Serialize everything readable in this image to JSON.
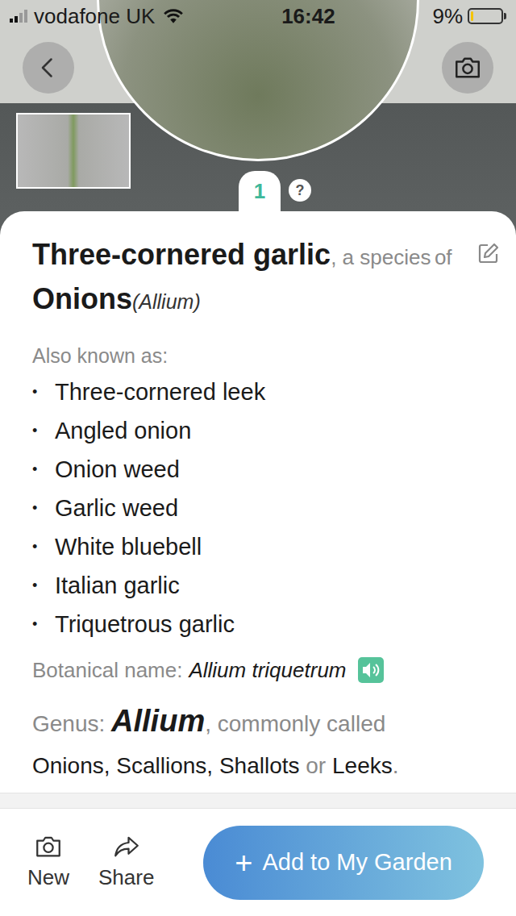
{
  "status_bar": {
    "carrier": "vodafone UK",
    "time": "16:42",
    "battery": "9%",
    "battery_level": 0.09
  },
  "header": {
    "photo_count": "1",
    "help": "?"
  },
  "plant": {
    "name": "Three-cornered garlic",
    "species_of": ", a species",
    "of": "of",
    "genus_common": "Onions",
    "genus_latin": "(Allium)"
  },
  "aliases_label": "Also known as:",
  "bullet": "•",
  "aliases": [
    "Three-cornered leek",
    "Angled onion",
    "Onion weed",
    "Garlic weed",
    "White bluebell",
    "Italian garlic",
    "Triquetrous garlic"
  ],
  "botanical": {
    "label": "Botanical name:",
    "value": "Allium triquetrum"
  },
  "genus": {
    "label": "Genus:",
    "value": "Allium",
    "suffix": ", commonly called",
    "names": "Onions, Scallions, Shallots",
    "or": "or",
    "last": "Leeks",
    "end": "."
  },
  "toolbar": {
    "new": "New",
    "share": "Share",
    "add_icon": "+",
    "add": "Add to My Garden"
  }
}
